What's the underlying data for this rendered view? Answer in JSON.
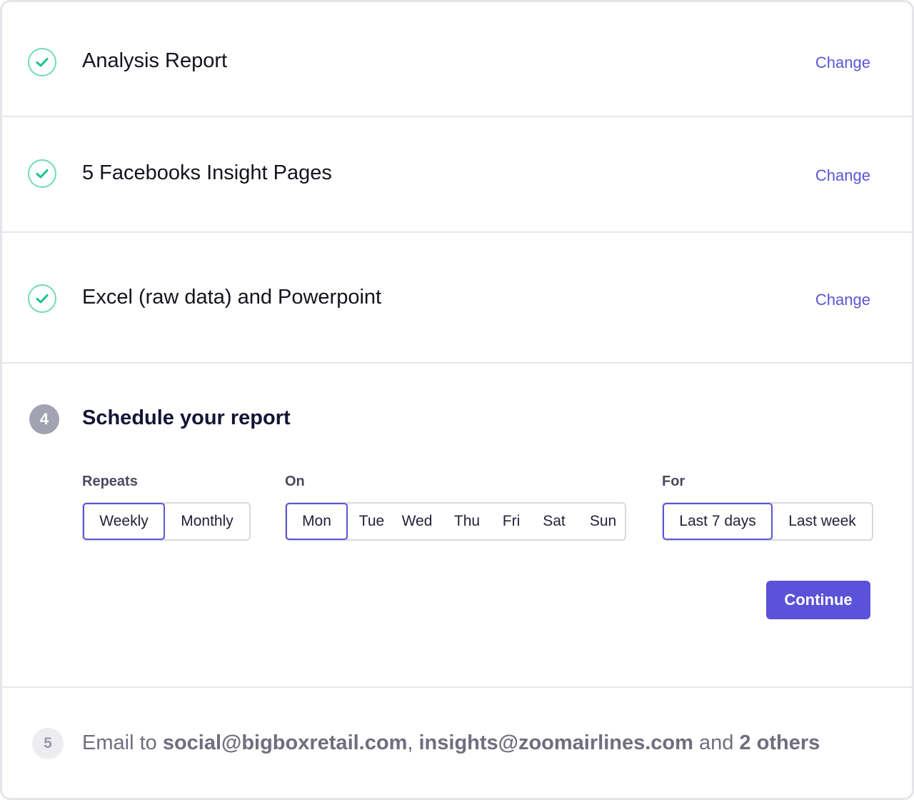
{
  "steps": {
    "report_type": {
      "title": "Analysis Report",
      "change_label": "Change"
    },
    "pages": {
      "title": "5 Facebooks Insight Pages",
      "change_label": "Change"
    },
    "format": {
      "title": "Excel (raw data) and Powerpoint",
      "change_label": "Change"
    },
    "schedule": {
      "number": "4",
      "title": "Schedule your report",
      "repeats": {
        "label": "Repeats",
        "options": [
          "Weekly",
          "Monthly"
        ],
        "selected": "Weekly"
      },
      "on": {
        "label": "On",
        "options": [
          "Mon",
          "Tue",
          "Wed",
          "Thu",
          "Fri",
          "Sat",
          "Sun"
        ],
        "selected": "Mon"
      },
      "for": {
        "label": "For",
        "options": [
          "Last 7 days",
          "Last week"
        ],
        "selected": "Last 7 days"
      },
      "continue_label": "Continue"
    },
    "email": {
      "number": "5",
      "prefix": "Email to",
      "recipient_1": "social@bigboxretail.com",
      "separator": ",",
      "recipient_2": "insights@zoomairlines.com",
      "connector": "and",
      "others": "2 others"
    }
  },
  "colors": {
    "accent": "#5b56d6",
    "check": "#2ecf95",
    "check_ring": "#6fdcb6",
    "step_badge": "#a2a2b2"
  },
  "icons": {
    "completed": "check-circle-icon"
  }
}
